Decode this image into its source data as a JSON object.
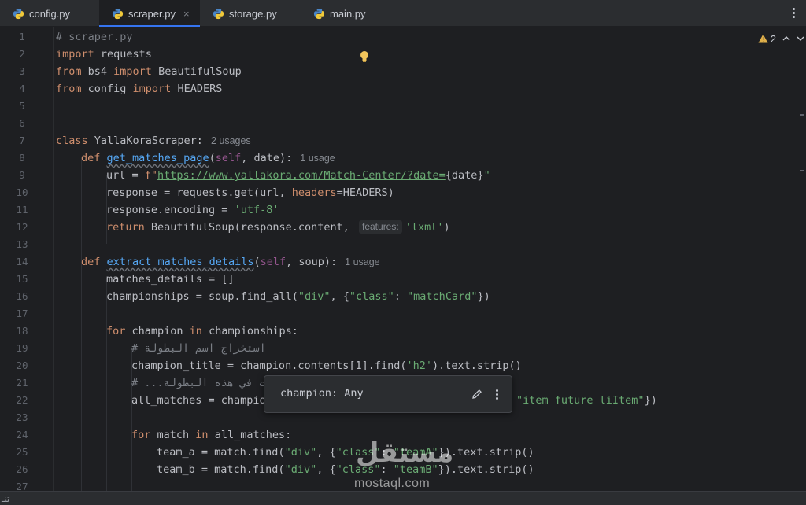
{
  "tabs": [
    {
      "label": "config.py",
      "active": false
    },
    {
      "label": "scraper.py",
      "active": true
    },
    {
      "label": "storage.py",
      "active": false
    },
    {
      "label": "main.py",
      "active": false
    }
  ],
  "tab_close_glyph": "×",
  "icons": {
    "file": "python-file-icon",
    "warning": "warning-triangle-icon",
    "up": "chevron-up-icon",
    "down": "chevron-down-icon",
    "bulb": "lightbulb-icon",
    "edit": "pencil-icon",
    "more": "more-vertical-icon"
  },
  "colors": {
    "keyword": "#cf8e6d",
    "function": "#56a8f5",
    "string": "#6aab73",
    "comment": "#7a7e85",
    "self": "#94558d",
    "accent": "#3574f0"
  },
  "inspection": {
    "warnings": "2"
  },
  "line_numbers": [
    "1",
    "2",
    "3",
    "4",
    "5",
    "6",
    "7",
    "8",
    "9",
    "10",
    "11",
    "12",
    "13",
    "14",
    "15",
    "16",
    "17",
    "18",
    "19",
    "20",
    "21",
    "22",
    "23",
    "24",
    "25",
    "26",
    "27"
  ],
  "code": {
    "l1": "# scraper.py",
    "l2_kw": "import",
    "l2_rest": " requests",
    "l3_kw1": "from",
    "l3_mod": " bs4 ",
    "l3_kw2": "import",
    "l3_rest": " BeautifulSoup",
    "l4_kw1": "from",
    "l4_mod": " config ",
    "l4_kw2": "import",
    "l4_rest": " HEADERS",
    "l7_kw": "class",
    "l7_rest": " YallaKoraScraper:",
    "l7_hint": "2 usages",
    "l8_kw": "def",
    "l8_fn": "get_matches_page",
    "l8_open": "(",
    "l8_self": "self",
    "l8_rest": ", date):",
    "l8_hint": "1 usage",
    "l9_a": "url = ",
    "l9_f": "f\"",
    "l9_url": "https://www.yallakora.com/Match-Center/?date=",
    "l9_b": "{date}",
    "l9_c": "\"",
    "l10_a": "response = requests.get(url, ",
    "l10_p": "headers",
    "l10_b": "=HEADERS)",
    "l11_a": "response.encoding = ",
    "l11_s": "'utf-8'",
    "l12_kw": "return",
    "l12_a": " BeautifulSoup(response.content, ",
    "l12_inlay": "features:",
    "l12_s": "'lxml'",
    "l12_b": ")",
    "l14_kw": "def",
    "l14_fn": "extract_matches_details",
    "l14_open": "(",
    "l14_self": "self",
    "l14_rest": ", soup):",
    "l14_hint": "1 usage",
    "l15": "matches_details = []",
    "l16_a": "championships = soup.find_all(",
    "l16_s1": "\"div\"",
    "l16_b": ", {",
    "l16_s2": "\"class\"",
    "l16_c": ": ",
    "l16_s3": "\"matchCard\"",
    "l16_d": "})",
    "l18_kw1": "for",
    "l18_a": " champion ",
    "l18_kw2": "in",
    "l18_b": " championships:",
    "l19": "# استخراج اسم البطولة",
    "l20_a": "champion_title = champion.contents[1].find(",
    "l20_s": "'h2'",
    "l20_b": ").text.strip()",
    "l21": "# ...ريات في هذه البطولة",
    "l22_a": "all_matches = champio",
    "l22_s": "\"item future liItem\"",
    "l22_b": "})",
    "l24_kw1": "for",
    "l24_a": " match ",
    "l24_kw2": "in",
    "l24_b": " all_matches:",
    "l25_a": "team_a = match.find(",
    "l25_s1": "\"div\"",
    "l25_b": ", {",
    "l25_s2": "\"class\"",
    "l25_c": ": ",
    "l25_s3": "\"teamA\"",
    "l25_d": "}).text.strip()",
    "l26_a": "team_b = match.find(",
    "l26_s1": "\"div\"",
    "l26_b": ", {",
    "l26_s2": "\"class\"",
    "l26_c": ": ",
    "l26_s3": "\"teamB\"",
    "l26_d": "}).text.strip()"
  },
  "popup": {
    "text": "champion: Any"
  },
  "status": {
    "fragment": "تنـ"
  },
  "watermark": {
    "arabic": "مستقل",
    "latin": "mostaql.com"
  }
}
